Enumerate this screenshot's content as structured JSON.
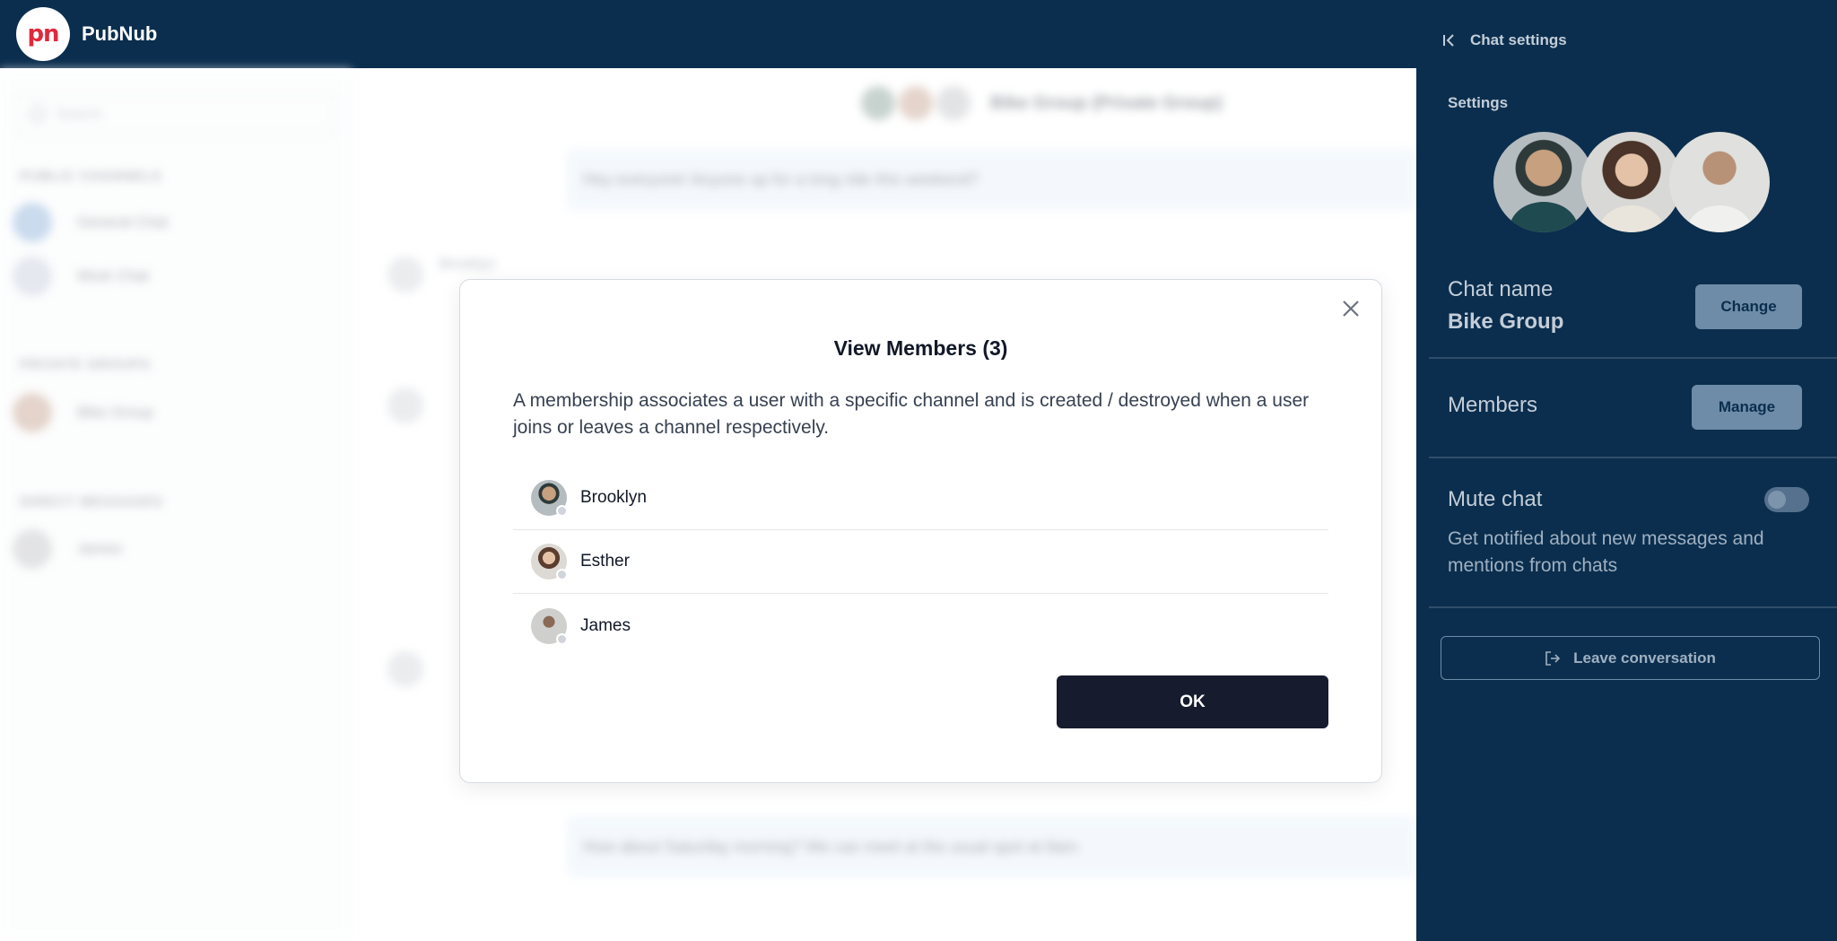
{
  "app": {
    "brand": "PubNub",
    "logo_text": "pn"
  },
  "background": {
    "search_placeholder": "Search",
    "sections": {
      "public": "PUBLIC CHANNELS",
      "private": "PRIVATE GROUPS",
      "direct": "DIRECT MESSAGES"
    },
    "channels": [
      "General Chat",
      "Work Chat"
    ],
    "groups": [
      "Bike Group"
    ],
    "dms": [
      "James"
    ],
    "header_title": "Bike Group (Private Group)",
    "sender": "Brooklyn",
    "messages": [
      "Hey everyone! Anyone up for a long ride this weekend?",
      "How about Saturday morning? We can meet at the usual spot at 8am."
    ]
  },
  "panel": {
    "title": "Chat settings",
    "settings_label": "Settings",
    "chat_name_label": "Chat name",
    "chat_name_value": "Bike Group",
    "change_label": "Change",
    "members_label": "Members",
    "manage_label": "Manage",
    "mute_label": "Mute chat",
    "mute_on": false,
    "mute_description": "Get notified about new messages and mentions from chats",
    "leave_label": "Leave conversation"
  },
  "modal": {
    "title": "View Members (3)",
    "description": "A membership associates a user with a specific channel and is created / destroyed when a user joins or leaves a channel respectively.",
    "members": [
      {
        "name": "Brooklyn"
      },
      {
        "name": "Esther"
      },
      {
        "name": "James"
      }
    ],
    "ok_label": "OK"
  },
  "colors": {
    "navy": "#0b2e4e",
    "button_dark": "#161c2d",
    "panel_button": "#6e8ca8",
    "logo_red": "#e0293d"
  }
}
